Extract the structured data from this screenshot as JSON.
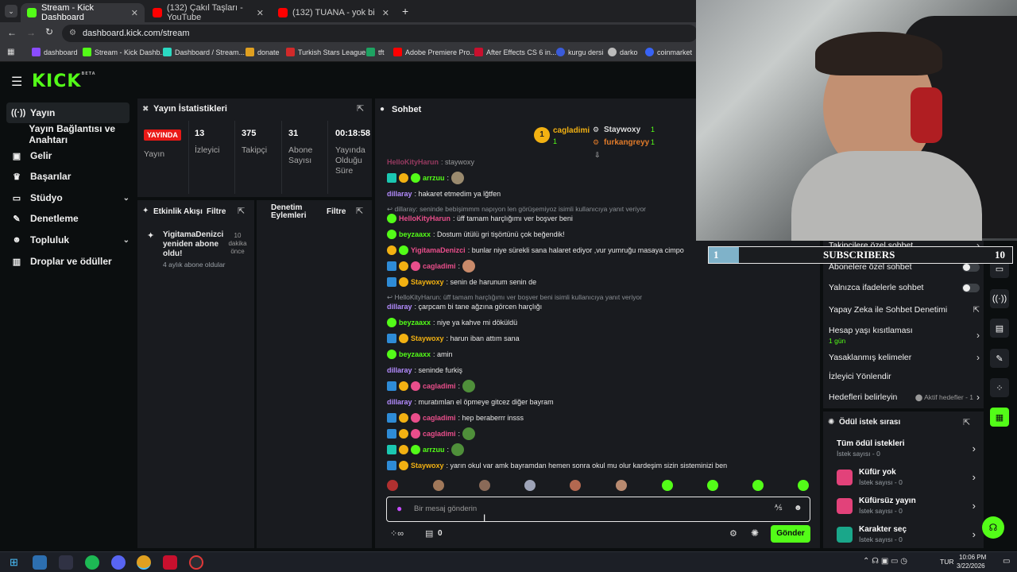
{
  "browser": {
    "tabs": [
      {
        "title": "Stream - Kick Dashboard",
        "active": true
      },
      {
        "title": "(132) Çakıl Taşları - YouTube",
        "active": false
      },
      {
        "title": "(132) TUANA - yok bi çare (",
        "active": false
      }
    ],
    "new_tab": "+",
    "url": "dashboard.kick.com/stream",
    "bookmarks": [
      "dashboard",
      "Stream - Kick Dashb...",
      "Dashboard / Stream...",
      "donate",
      "Turkish Stars League...",
      "tft",
      "Adobe Premiere Pro...",
      "After Effects CS 6 in...",
      "kurgu dersi",
      "darko",
      "coinmarket"
    ]
  },
  "kick": {
    "logo": "KICK",
    "logo_sup": "BETA",
    "sidebar": [
      {
        "label": "Yayın",
        "icon": "broadcast-icon",
        "active": true
      },
      {
        "label": "Yayın Bağlantısı ve Anahtarı",
        "icon": "",
        "active": false
      },
      {
        "label": "Gelir",
        "icon": "income-icon",
        "active": false
      },
      {
        "label": "Başarılar",
        "icon": "trophy-icon",
        "active": false
      },
      {
        "label": "Stüdyo",
        "icon": "studio-icon",
        "active": false
      },
      {
        "label": "Denetleme",
        "icon": "wrench-icon",
        "active": false
      },
      {
        "label": "Topluluk",
        "icon": "community-icon",
        "active": false
      },
      {
        "label": "Droplar ve ödüller",
        "icon": "drops-icon",
        "active": false
      }
    ],
    "stats": {
      "title": "Yayın İstatistikleri",
      "live_badge": "YAYINDA",
      "live_label": "Yayın",
      "viewers": "13",
      "viewers_label": "İzleyici",
      "followers": "375",
      "followers_label": "Takipçi",
      "subs": "31",
      "subs_label": "Abone Sayısı",
      "duration": "00:18:58",
      "duration_label": "Yayında Olduğu Süre"
    },
    "activity": {
      "title": "Etkinlik Akışı",
      "filter": "Filtre",
      "item_name": "YigitamaDenizci yeniden abone oldu!",
      "item_time": "10 dakika önce",
      "item_detail": "4 aylık abone oldular"
    },
    "moderation": {
      "title": "Denetim Eylemleri",
      "filter": "Filtre"
    },
    "chat": {
      "title": "Sohbet",
      "top_gifters": [
        {
          "name": "cagladimi",
          "count": "1",
          "rank": "1"
        },
        {
          "name": "Staywoxy",
          "count": "1"
        },
        {
          "name": "furkangreyy",
          "count": "1"
        }
      ],
      "messages": [
        {
          "user": "HelloKityHarun",
          "text": ": staywoxy",
          "color": "#e94e8b"
        },
        {
          "user": "arrzuu",
          "text": ":",
          "color": "#53fc18"
        },
        {
          "user": "dillaray",
          "text": ": hakaret etmedim ya lğtfen",
          "color": "#b48cff"
        },
        {
          "reply": "dillaray: seninde bebişimmm napıyon len görüşemiyoz isimli kullanıcıya yanıt veriyor"
        },
        {
          "user": "HelloKityHarun",
          "text": ": üff tamam harçlığımı ver boşver beni",
          "color": "#e94e8b"
        },
        {
          "user": "beyzaaxx",
          "text": ": Dostum ütülü gri tişörtünü çok beğendik!",
          "color": "#53fc18"
        },
        {
          "user": "YigitamaDenizci",
          "text": ": bunlar niye sürekli sana halaret ediyor ,vur yumruğu masaya cimpo",
          "color": "#e94e8b"
        },
        {
          "user": "cagladimi",
          "text": ":",
          "color": "#e94e8b"
        },
        {
          "user": "Staywoxy",
          "text": ": senin de harunum senin de",
          "color": "#f2b112"
        },
        {
          "reply": "HelloKityHarun: üff tamam harçlığımı ver boşver beni isimli kullanıcıya yanıt veriyor"
        },
        {
          "user": "dillaray",
          "text": ": çarpcam bi tane ağzına görcen harçlığı",
          "color": "#b48cff"
        },
        {
          "user": "beyzaaxx",
          "text": ": niye ya kahve mi döküldü",
          "color": "#53fc18"
        },
        {
          "user": "Staywoxy",
          "text": ": harun iban attım sana",
          "color": "#f2b112"
        },
        {
          "user": "beyzaaxx",
          "text": ": amin",
          "color": "#53fc18"
        },
        {
          "user": "dillaray",
          "text": ": seninde furkiş",
          "color": "#b48cff"
        },
        {
          "user": "cagladimi",
          "text": ":",
          "color": "#e94e8b"
        },
        {
          "user": "dillaray",
          "text": ": muratımlan el öpmeye gitcez diğer bayram",
          "color": "#b48cff"
        },
        {
          "user": "cagladimi",
          "text": ": hep beraberrr insss",
          "color": "#e94e8b"
        },
        {
          "user": "cagladimi",
          "text": ":",
          "color": "#e94e8b"
        },
        {
          "user": "arrzuu",
          "text": ":",
          "color": "#53fc18"
        },
        {
          "user": "Staywoxy",
          "text": ": yarın okul var amk bayramdan hemen sonra okul mu olur kardeşim sizin sisteminizi ben",
          "color": "#f2b112"
        }
      ],
      "input_placeholder": "Bir mesaj gönderin",
      "points": "0",
      "send": "Gönder"
    },
    "settings": {
      "followers_only": "Takipçilere özel sohbet",
      "subs_only": "Abonelere özel sohbet",
      "emote_only": "Yalnızca ifadelerle sohbet",
      "ai_mod": "Yapay Zeka ile Sohbet Denetimi",
      "age_limit": "Hesap yaşı kısıtlaması",
      "age_value": "1 gün",
      "banned_words": "Yasaklanmış kelimeler",
      "redirect": "İzleyici Yönlendir",
      "goals": "Hedefleri belirleyin",
      "goals_status": "Aktif hedefler - 1"
    },
    "rewards": {
      "title": "Ödül istek sırası",
      "items": [
        {
          "label": "Tüm ödül istekleri",
          "count": "İstek sayısı - 0"
        },
        {
          "label": "Küfür yok",
          "count": "İstek sayısı - 0"
        },
        {
          "label": "Küfürsüz yayın",
          "count": "İstek sayısı - 0"
        },
        {
          "label": "Karakter seç",
          "count": "İstek sayısı - 0"
        }
      ]
    }
  },
  "overlay": {
    "sub_count": "1",
    "sub_label": "SUBSCRIBERS",
    "sub_goal": "10"
  },
  "taskbar": {
    "lang": "TUR",
    "time": "10:06 PM",
    "date": "3/22/2026"
  }
}
